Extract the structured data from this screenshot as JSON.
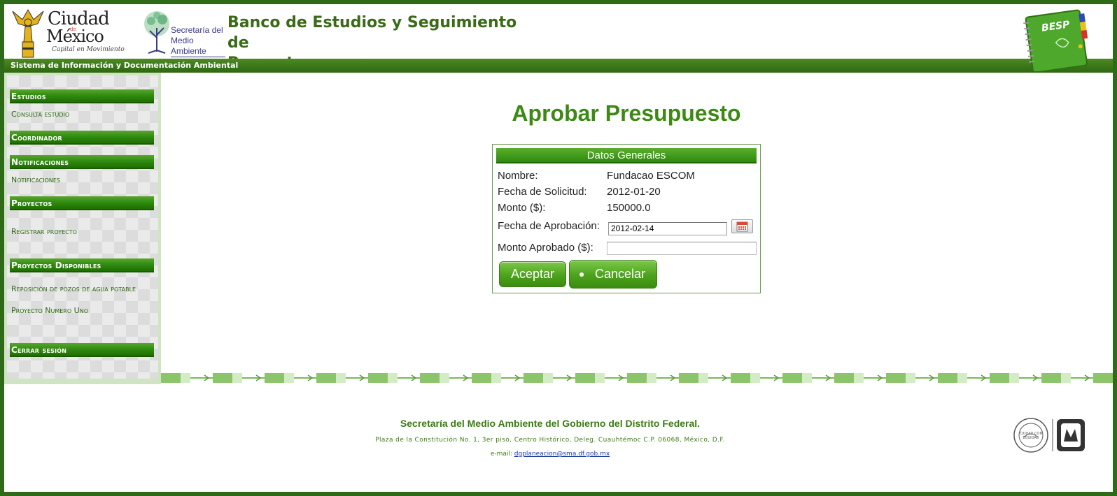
{
  "header": {
    "cdmx_logo": {
      "line1": "Ciudad",
      "line2": "México",
      "small": "de",
      "tagline": "Capital en Movimiento"
    },
    "sma_logo": {
      "line1": "Secretaría del",
      "line2": "Medio Ambiente"
    },
    "title_line1": "Banco de Estudios y Seguimiento de",
    "title_line2": "Proyectos",
    "besp_label": "BESP",
    "subbar": "Sistema de Información y Documentación Ambiental"
  },
  "sidebar": {
    "sections": [
      {
        "title": "Estudios",
        "links": [
          "Consulta estudio"
        ]
      },
      {
        "title": "Coordinador",
        "links": []
      },
      {
        "title": "Notificaciones",
        "links": [
          "Notificaciones"
        ]
      },
      {
        "title": "Proyectos",
        "links": [
          "Registrar proyecto"
        ]
      },
      {
        "title": "Proyectos Disponibles",
        "links": [
          "Reposición de pozos de agua potable",
          "Proyecto Numero Uno"
        ]
      },
      {
        "title": "Cerrar sesión",
        "links": []
      }
    ]
  },
  "main": {
    "page_title": "Aprobar Presupuesto",
    "panel_title": "Datos Generales",
    "fields": {
      "nombre_label": "Nombre:",
      "nombre_value": "Fundacao ESCOM",
      "fecha_solicitud_label": "Fecha de Solicitud:",
      "fecha_solicitud_value": "2012-01-20",
      "monto_label": "Monto ($):",
      "monto_value": "150000.0",
      "fecha_aprobacion_label": "Fecha de Aprobación:",
      "fecha_aprobacion_value": "2012-02-14",
      "monto_aprobado_label": "Monto Aprobado ($):",
      "monto_aprobado_value": ""
    },
    "buttons": {
      "aceptar": "Aceptar",
      "cancelar": "Cancelar"
    }
  },
  "footer": {
    "title": "Secretaría del Medio Ambiente del Gobierno del Distrito Federal.",
    "address": "Plaza de la Constitución No. 1, 3er piso, Centro Histórico, Deleg. Cuauhtémoc C.P. 06068, México, D.F.",
    "email_label": "e-mail:",
    "email": "dgplaneacion@sma.df.gob.mx",
    "seal_text": "CIUDAD CON EQUIDAD"
  },
  "colors": {
    "accent": "#3c8a14",
    "frame": "#2f6a18",
    "header_green": "#3b6a18"
  }
}
